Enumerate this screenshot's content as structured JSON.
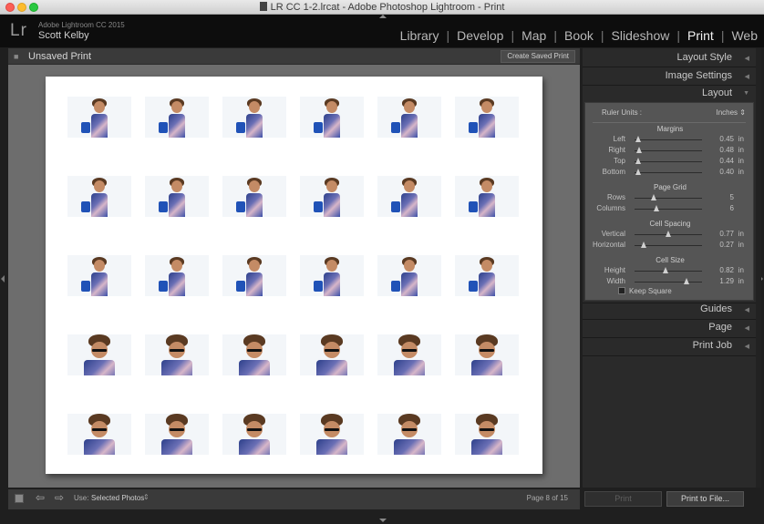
{
  "window": {
    "title": "LR CC 1-2.lrcat - Adobe Photoshop Lightroom - Print"
  },
  "identity": {
    "logo": "Lr",
    "version": "Adobe Lightroom CC 2015",
    "user": "Scott Kelby"
  },
  "modules": [
    "Library",
    "Develop",
    "Map",
    "Book",
    "Slideshow",
    "Print",
    "Web"
  ],
  "active_module": "Print",
  "center": {
    "title": "Unsaved Print",
    "create_saved_label": "Create Saved Print"
  },
  "contact_sheet": {
    "rows": 5,
    "columns": 6
  },
  "right_panel": {
    "layout_style": "Layout Style",
    "image_settings": "Image Settings",
    "layout": "Layout",
    "ruler_units_label": "Ruler Units :",
    "ruler_units_value": "Inches",
    "margins_title": "Margins",
    "page_grid_title": "Page Grid",
    "cell_spacing_title": "Cell Spacing",
    "cell_size_title": "Cell Size",
    "sliders": [
      {
        "label": "Left",
        "value": "0.45",
        "unit": "in",
        "level": 0.06
      },
      {
        "label": "Right",
        "value": "0.48",
        "unit": "in",
        "level": 0.07
      },
      {
        "label": "Top",
        "value": "0.44",
        "unit": "in",
        "level": 0.06
      },
      {
        "label": "Bottom",
        "value": "0.40",
        "unit": "in",
        "level": 0.05
      },
      {
        "label": "Rows",
        "value": "5",
        "unit": "",
        "level": 0.28
      },
      {
        "label": "Columns",
        "value": "6",
        "unit": "",
        "level": 0.33
      },
      {
        "label": "Vertical",
        "value": "0.77",
        "unit": "in",
        "level": 0.5
      },
      {
        "label": "Horizontal",
        "value": "0.27",
        "unit": "in",
        "level": 0.14
      },
      {
        "label": "Height",
        "value": "0.82",
        "unit": "in",
        "level": 0.46
      },
      {
        "label": "Width",
        "value": "1.29",
        "unit": "in",
        "level": 0.77
      }
    ],
    "keep_square": "Keep Square",
    "guides": "Guides",
    "page": "Page",
    "print_job": "Print Job"
  },
  "toolbar": {
    "use_label": "Use:",
    "use_value": "Selected Photos",
    "page_indicator": "Page 8 of 15"
  },
  "buttons": {
    "print": "Print",
    "print_to_file": "Print to File..."
  }
}
